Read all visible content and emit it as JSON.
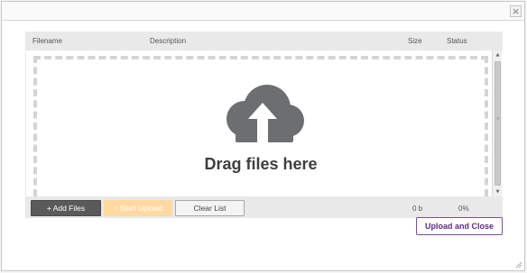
{
  "dialog": {
    "close_label": "×"
  },
  "table": {
    "headers": {
      "filename": "Filename",
      "description": "Description",
      "size": "Size",
      "status": "Status"
    }
  },
  "dropzone": {
    "text": "Drag files here",
    "icon": "cloud-upload-icon"
  },
  "scrollbar": {
    "up_arrow": "▲",
    "down_arrow": "▼",
    "grip": "≡"
  },
  "footer": {
    "add_files_label": "+ Add Files",
    "start_upload_label": "↑ Start Upload",
    "clear_list_label": "Clear List",
    "total_size": "0 b",
    "total_percent": "0%"
  },
  "actions": {
    "upload_and_close_label": "Upload and Close"
  },
  "colors": {
    "add_files_bg": "#5a5a5a",
    "start_upload_bg": "#ffd9a0",
    "accent_purple": "#5e2a82",
    "cloud_icon": "#6d6e70"
  }
}
